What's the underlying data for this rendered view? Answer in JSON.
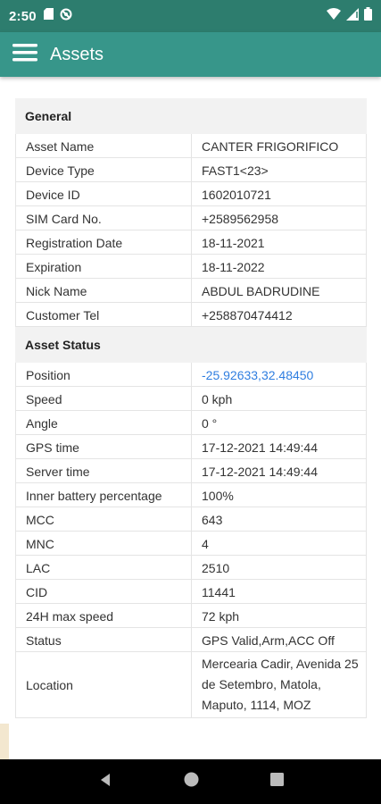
{
  "status_bar": {
    "time": "2:50",
    "icons": [
      "sd-card-icon",
      "blocked-icon",
      "wifi-icon",
      "signal-icon",
      "battery-icon"
    ]
  },
  "app_bar": {
    "title": "Assets",
    "menu_icon": "hamburger-menu-icon"
  },
  "general": {
    "header": "General",
    "rows": [
      {
        "label": "Asset Name",
        "value": "CANTER FRIGORIFICO"
      },
      {
        "label": "Device Type",
        "value": "FAST1<23>"
      },
      {
        "label": "Device ID",
        "value": "1602010721"
      },
      {
        "label": "SIM Card No.",
        "value": "+2589562958"
      },
      {
        "label": "Registration Date",
        "value": "18-11-2021"
      },
      {
        "label": "Expiration",
        "value": "18-11-2022"
      },
      {
        "label": "Nick Name",
        "value": "ABDUL BADRUDINE"
      },
      {
        "label": "Customer Tel",
        "value": "+258870474412"
      }
    ]
  },
  "asset_status": {
    "header": "Asset Status",
    "rows": [
      {
        "label": "Position",
        "value": "-25.92633,32.48450"
      },
      {
        "label": "Speed",
        "value": "0 kph"
      },
      {
        "label": "Angle",
        "value": "0 °"
      },
      {
        "label": "GPS time",
        "value": "17-12-2021 14:49:44"
      },
      {
        "label": "Server time",
        "value": "17-12-2021 14:49:44"
      },
      {
        "label": "Inner battery percentage",
        "value": "100%"
      },
      {
        "label": "MCC",
        "value": "643"
      },
      {
        "label": "MNC",
        "value": "4"
      },
      {
        "label": "LAC",
        "value": "2510"
      },
      {
        "label": "CID",
        "value": "11441"
      },
      {
        "label": "24H max speed",
        "value": "72 kph"
      },
      {
        "label": "Status",
        "value": "GPS Valid,Arm,ACC Off"
      },
      {
        "label": "Location",
        "value": "Mercearia Cadir, Avenida 25 de Setembro, Matola, Maputo, 1114, MOZ"
      }
    ]
  },
  "colors": {
    "status_bar": "#2d7d6e",
    "app_bar": "#37968a",
    "link": "#2f7ee0",
    "section_bg": "#f2f2f2"
  },
  "nav_bar": {
    "icons": [
      "back-icon",
      "home-icon",
      "recents-icon"
    ]
  }
}
